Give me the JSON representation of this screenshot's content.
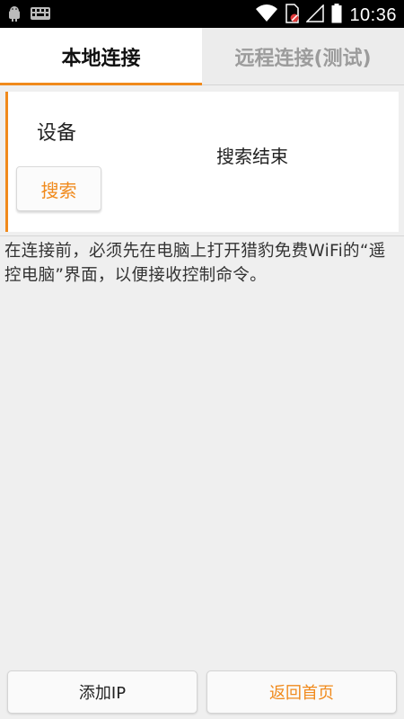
{
  "status_bar": {
    "time": "10:36",
    "icons": [
      "android-icon",
      "keyboard-icon",
      "wifi-icon",
      "no-sim-icon",
      "signal-icon",
      "battery-icon"
    ]
  },
  "tabs": [
    {
      "label": "本地连接",
      "active": true
    },
    {
      "label": "远程连接(测试)",
      "active": false
    }
  ],
  "device_panel": {
    "label": "设备",
    "status": "搜索结束",
    "search_button": "搜索"
  },
  "hint_text": "在连接前，必须先在电脑上打开猎豹免费WiFi的“遥控电脑”界面，以便接收控制命令。",
  "buttons": {
    "add_ip": "添加IP",
    "back_home": "返回首页"
  },
  "colors": {
    "accent": "#f08a1c",
    "status_bar": "#000000",
    "background": "#efefef"
  }
}
